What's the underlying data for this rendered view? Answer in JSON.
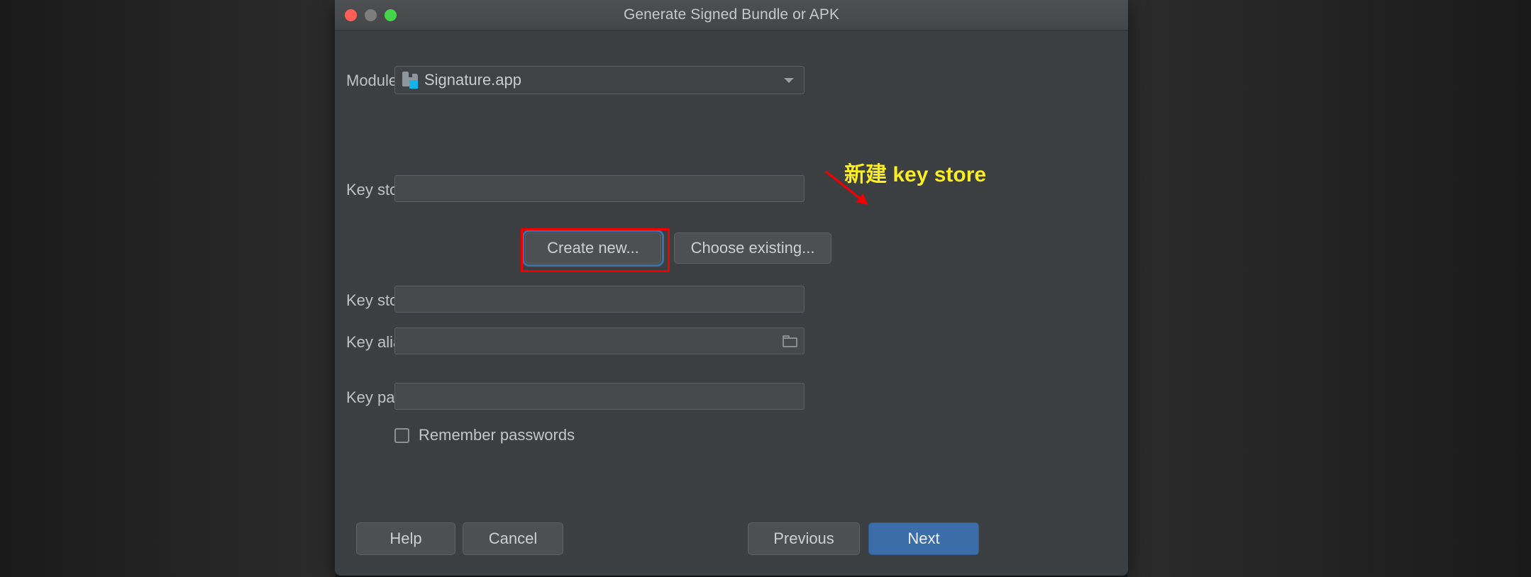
{
  "window": {
    "title": "Generate Signed Bundle or APK",
    "traffic_lights": [
      {
        "name": "close",
        "color": "#ff5f57"
      },
      {
        "name": "minimize",
        "color": "#7d7d7d"
      },
      {
        "name": "maximize",
        "color": "#44d54a"
      }
    ]
  },
  "form": {
    "module": {
      "label": "Module",
      "value": "Signature.app",
      "icon": "folder-module-icon",
      "dropdown_icon": "chevron-down-icon"
    },
    "key_store_path": {
      "label": "Key store path",
      "value": "",
      "placeholder": ""
    },
    "create_new": {
      "label": "Create new..."
    },
    "choose_existing": {
      "label": "Choose existing..."
    },
    "key_store_password": {
      "label": "Key store password",
      "value": "",
      "placeholder": ""
    },
    "key_alias": {
      "label": "Key alias",
      "value": "",
      "placeholder": "",
      "icon": "folder-browse-icon"
    },
    "key_password": {
      "label": "Key password",
      "value": "",
      "placeholder": ""
    },
    "remember_passwords": {
      "label": "Remember passwords",
      "checked": false
    }
  },
  "footer": {
    "help": "Help",
    "cancel": "Cancel",
    "previous": "Previous",
    "next": "Next"
  },
  "annotation": {
    "text": "新建 key store",
    "text_color": "#fcee21",
    "arrow_color": "#f10000",
    "highlight_color": "#f10000"
  },
  "colors": {
    "dialog_background": "#3c3f41",
    "titlebar_background": "#4a4c4e",
    "field_background": "#45494a",
    "field_border": "#5c6063",
    "text_primary": "#c0c2c4",
    "accent_primary": "#3b6ea8",
    "focus_ring": "#3b74a8",
    "module_badge": "#12b5ea"
  }
}
